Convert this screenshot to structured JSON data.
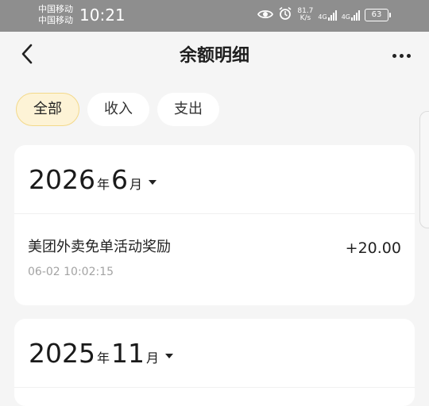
{
  "status_bar": {
    "carrier_1": "中国移动",
    "carrier_2": "中国移动",
    "time": "10:21",
    "speed_value": "81.7",
    "speed_unit": "K/s",
    "network_1": "4G",
    "network_2": "4G",
    "battery": "63",
    "icons": [
      "eye-icon",
      "alarm-icon",
      "signal-icon",
      "battery-icon"
    ]
  },
  "nav": {
    "title": "余额明细",
    "back_icon": "chevron-left-icon",
    "more_icon": "more-dots-icon"
  },
  "filters": [
    {
      "label": "全部",
      "active": true
    },
    {
      "label": "收入",
      "active": false
    },
    {
      "label": "支出",
      "active": false
    }
  ],
  "months": [
    {
      "year": "2026",
      "year_unit": "年",
      "month": "6",
      "month_unit": "月",
      "transactions": [
        {
          "title": "美团外卖免单活动奖励",
          "time": "06-02 10:02:15",
          "amount": "+20.00"
        }
      ]
    },
    {
      "year": "2025",
      "year_unit": "年",
      "month": "11",
      "month_unit": "月",
      "transactions": []
    }
  ],
  "colors": {
    "background": "#f5f5f5",
    "status_bar": "#8e8e8e",
    "active_chip": "#fdf3d6",
    "active_chip_border": "#f3d98a",
    "secondary_text": "#a3a3a3"
  }
}
